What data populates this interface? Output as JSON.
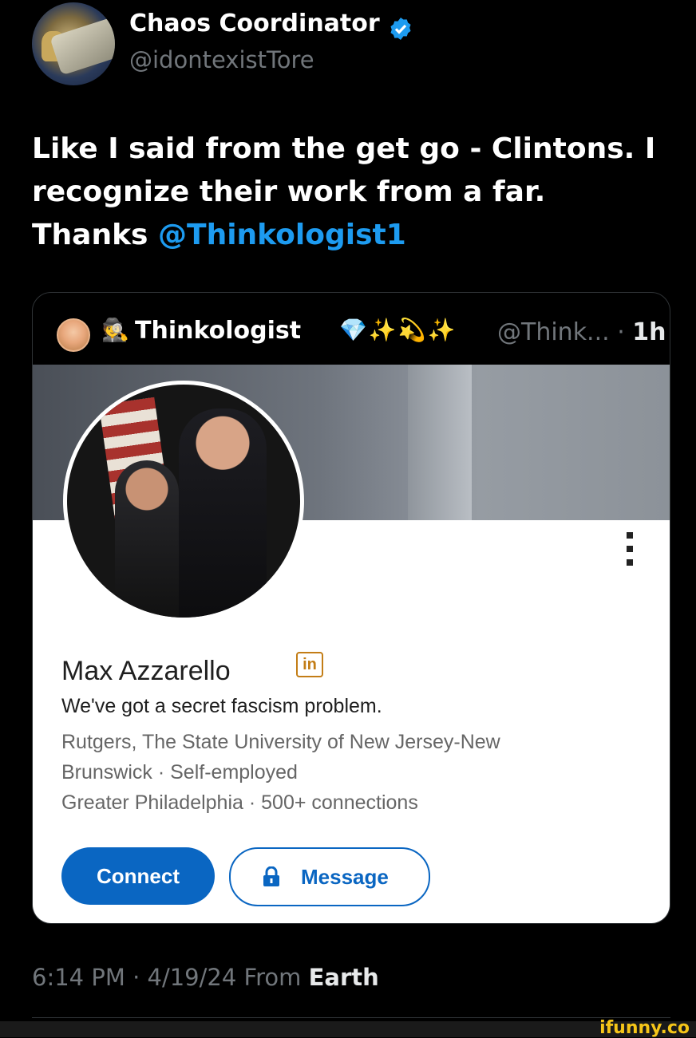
{
  "tweet": {
    "author": {
      "display_name": "Chaos Coordinator",
      "handle": "@idontexistTore",
      "verified_icon": "verified-badge-icon"
    },
    "more_label": "···",
    "text_before_mention": "Like I said from the get go - Clintons. I recognize their work from a far. Thanks",
    "mention": "@Thinkologist1",
    "timestamp": "6:14 PM · 4/19/24",
    "source_prefix": "From ",
    "source": "Earth"
  },
  "quote": {
    "spy_emoji": "🕵",
    "display_name": "Thinkologist",
    "emojis": "💎✨💫✨",
    "handle": "@Think...",
    "time_sep": " · ",
    "time": "1h"
  },
  "linkedin": {
    "name": "Max Azzarello",
    "badge": "in",
    "headline": "We've got a secret fascism problem.",
    "education_line1": "Rutgers, The State University of New Jersey-New",
    "education_line2": "Brunswick  ·  Self-employed",
    "location_line": "Greater Philadelphia  ·  500+ connections",
    "connect_label": "Connect",
    "message_label": "Message",
    "colors": {
      "primary": "#0a66c2",
      "badge": "#c37d16"
    }
  },
  "watermark": "ifunny.co"
}
